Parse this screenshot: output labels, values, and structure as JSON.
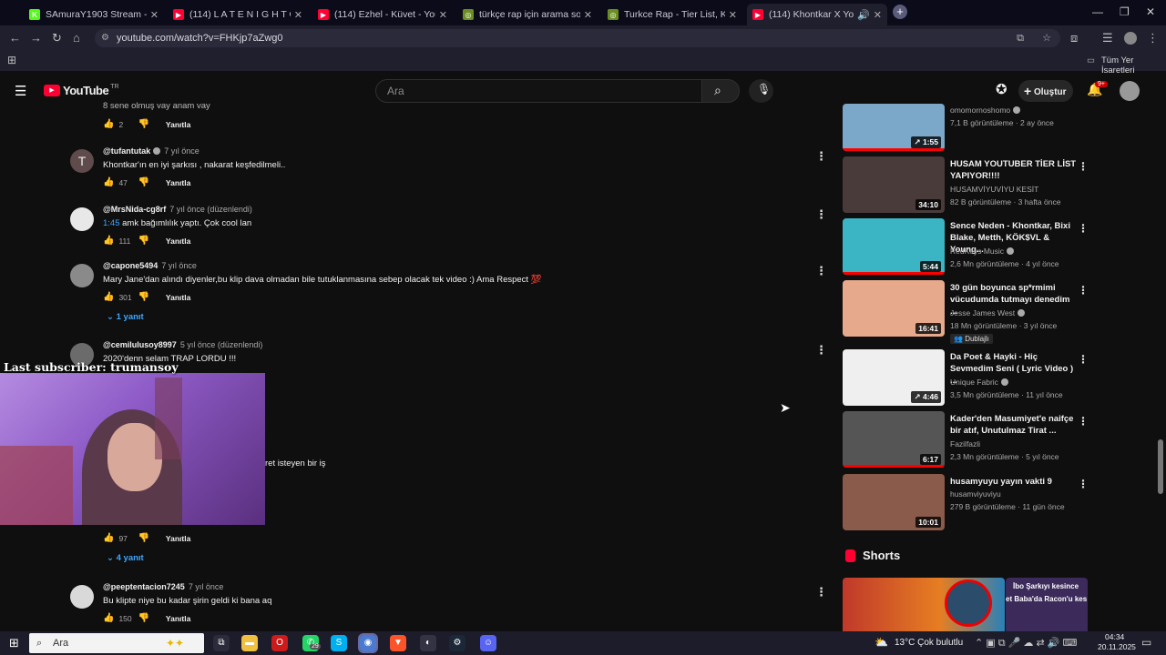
{
  "browser": {
    "tabs": [
      {
        "label": "SAmuraY1903 Stream - Kick Da",
        "favicon": "kick-icon",
        "color": "#53fc18",
        "glyph": "K"
      },
      {
        "label": "(114) L A T E N I G H T C",
        "favicon": "youtube-icon",
        "color": "#ff0033",
        "glyph": "▶"
      },
      {
        "label": "(114) Ezhel - Küvet - YouTube",
        "favicon": "youtube-icon",
        "color": "#ff0033",
        "glyph": "▶"
      },
      {
        "label": "türkçe rap için arama sonuçları",
        "favicon": "globe-icon",
        "color": "#6b8e23",
        "glyph": "◎"
      },
      {
        "label": "Turkce Rap - Tier List, Kör Sırala",
        "favicon": "tiermaker-icon",
        "color": "#6b8e23",
        "glyph": "◎"
      },
      {
        "label": "(114) Khontkar X Young Be",
        "favicon": "youtube-icon",
        "color": "#ff0033",
        "glyph": "▶"
      }
    ],
    "url": "youtube.com/watch?v=FHKjp7aZwg0",
    "bookmarks_label": "Tüm Yer İşaretleri"
  },
  "youtube": {
    "logo_text": "YouTube",
    "logo_sup": "TR",
    "search_placeholder": "Ara",
    "create_label": "Oluştur",
    "notif_badge": "9+"
  },
  "comments": [
    {
      "author": "",
      "time": "",
      "text": "8 sene olmuş vay anam vay",
      "likes": "2",
      "reply_label": "Yanıtla",
      "replies": ""
    },
    {
      "author": "@tufantutak",
      "verified": true,
      "time": "7 yıl önce",
      "text": "Khontkar'ın en iyi şarkısı , nakarat keşfedilmeli..",
      "likes": "47",
      "reply_label": "Yanıtla",
      "avatar_letter": "T",
      "avatar_color": "#5f4b4b"
    },
    {
      "author": "@MrsNida-cg8rf",
      "time": "7 yıl önce (düzenlendi)",
      "ts": "1:45",
      "text": " amk bağımlılık yaptı. Çok cool lan",
      "likes": "111",
      "reply_label": "Yanıtla",
      "avatar_color": "#e8e8e8"
    },
    {
      "author": "@capone5494",
      "time": "7 yıl önce",
      "text": "Mary Jane'dan alındı diyenler,bu klip dava olmadan bile tutuklanmasına sebep olacak tek video :) Ama Respect 💯",
      "likes": "301",
      "reply_label": "Yanıtla",
      "replies": "1 yanıt",
      "avatar_color": "#8a8a8a"
    },
    {
      "author": "@cemilulusoy8997",
      "time": "5 yıl önce (düzenlendi)",
      "text": "2020'denn selam TRAP LORDU !!!",
      "extra": "ret isteyen bir iş",
      "likes": "97",
      "reply_label": "Yanıtla",
      "replies": "4 yanıt",
      "avatar_color": "#6b6b6b"
    },
    {
      "author": "@peeptentacion7245",
      "time": "7 yıl önce",
      "text": "Bu klipte niye bu kadar şirin geldi ki bana aq",
      "likes": "150",
      "reply_label": "Yanıtla",
      "avatar_color": "#d9d9d9"
    }
  ],
  "sidebar_videos": [
    {
      "title": "",
      "channel": "omomornoshomo",
      "verified": true,
      "meta": "7,1 B görüntüleme · 2 ay önce",
      "duration": "1:55",
      "short_icon": true,
      "thumb_color": "#7ba7c9"
    },
    {
      "title": "HUSAM YOUTUBER TİER LİST YAPIYOR!!!!",
      "channel": "HUSAMVİYUVİYU KESİT",
      "meta": "82 B görüntüleme · 3 hafta önce",
      "duration": "34:10",
      "thumb_color": "#4a3b3b"
    },
    {
      "title": "Sence Neden - Khontkar, Bixi Blake, Metth, KÖK$VL & Young...",
      "channel": "RedKeys Music",
      "verified": true,
      "meta": "2,6 Mn görüntüleme · 4 yıl önce",
      "duration": "5:44",
      "thumb_color": "#3bb5c4"
    },
    {
      "title": "30 gün boyunca sp*rmimi vücudumda tutmayı denedim ...",
      "channel": "Jesse James West",
      "verified": true,
      "meta": "18 Mn görüntüleme · 3 yıl önce",
      "badge": "Dublajlı",
      "duration": "16:41",
      "thumb_color": "#e6a98c"
    },
    {
      "title": "Da Poet & Hayki - Hiç Sevmedim Seni ( Lyric Video ) ...",
      "channel": "Unique Fabric",
      "verified": true,
      "meta": "3,5 Mn görüntüleme · 11 yıl önce",
      "duration": "4:46",
      "short_icon": true,
      "thumb_color": "#efefef"
    },
    {
      "title": "Kader'den Masumiyet'e naifçe bir atıf, Unutulmaz Tirat ...",
      "channel": "Fazilfazli",
      "meta": "2,3 Mn görüntüleme · 5 yıl önce",
      "duration": "6:17",
      "thumb_color": "#555555"
    },
    {
      "title": "husamyuyu yayın vakti 9",
      "channel": "husamviyuviyu",
      "meta": "279 B görüntüleme · 11 gün önce",
      "duration": "10:01",
      "thumb_color": "#8a5a4a"
    }
  ],
  "shorts": {
    "heading": "Shorts",
    "overlay_text_1": "İbo Şarkıyı kesince",
    "overlay_text_2": "et Baba'da Racon'u kes"
  },
  "overlay": {
    "subscriber_line": "Last subscriber: trumansoy"
  },
  "taskbar": {
    "search_label": "Ara",
    "whatsapp_badge": "29",
    "weather": "13°C  Çok bulutlu",
    "time": "04:34",
    "date": "20.11.2025"
  }
}
